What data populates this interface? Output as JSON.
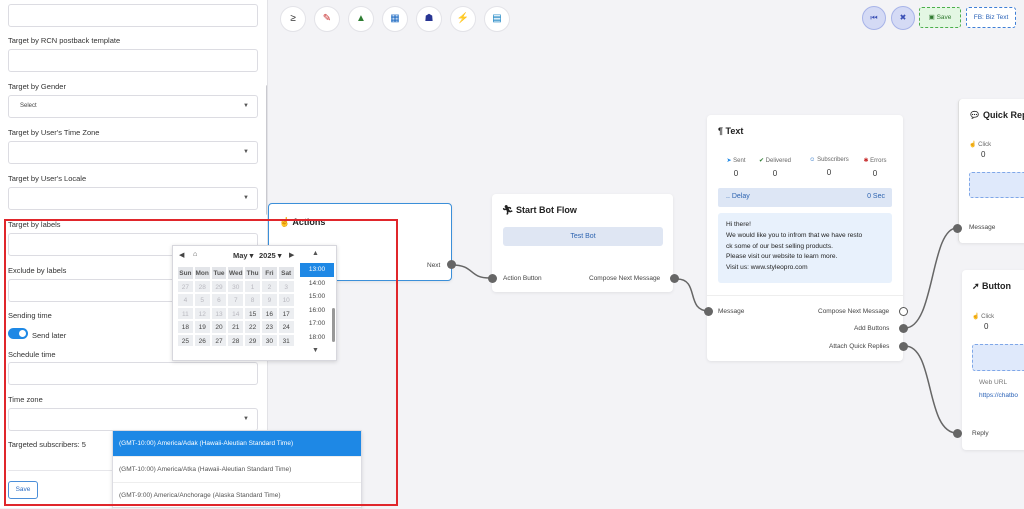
{
  "left_panel": {
    "fields": [
      {
        "label": "Target by RCN postback template"
      },
      {
        "label": "Target by Gender",
        "value": "Select"
      },
      {
        "label": "Target by User's Time Zone"
      },
      {
        "label": "Target by User's Locale"
      },
      {
        "label": "Target by labels"
      },
      {
        "label": "Exclude by labels"
      }
    ],
    "sending_time_label": "Sending time",
    "send_later_label": "Send later",
    "schedule_time_label": "Schedule time",
    "time_zone_label": "Time zone",
    "targeted_subscribers_label": "Targeted subscribers: 5",
    "save_label": "Save"
  },
  "datepicker": {
    "month": "May",
    "year": "2025",
    "weekdays": [
      "Sun",
      "Mon",
      "Tue",
      "Wed",
      "Thu",
      "Fri",
      "Sat"
    ],
    "weeks": [
      [
        "27",
        "28",
        "29",
        "30",
        "1",
        "2",
        "3"
      ],
      [
        "4",
        "5",
        "6",
        "7",
        "8",
        "9",
        "10"
      ],
      [
        "11",
        "12",
        "13",
        "14",
        "15",
        "16",
        "17"
      ],
      [
        "18",
        "19",
        "20",
        "21",
        "22",
        "23",
        "24"
      ],
      [
        "25",
        "26",
        "27",
        "28",
        "29",
        "30",
        "31"
      ]
    ],
    "times": [
      "13:00",
      "14:00",
      "15:00",
      "16:00",
      "17:00",
      "18:00"
    ],
    "selected_time": "13:00"
  },
  "timezone_options": [
    "(GMT-10:00) America/Adak (Hawaii-Aleutian Standard Time)",
    "(GMT-10:00) America/Atka (Hawaii-Aleutian Standard Time)",
    "(GMT-9:00) America/Anchorage (Alaska Standard Time)"
  ],
  "toolbar": {
    "save_label": "Save",
    "flow_name": "FB: Biz Text",
    "tool_icons": [
      "greater-equal-icon",
      "subscriber-icon",
      "chart-icon",
      "cards-icon",
      "robot-icon",
      "plug-icon",
      "file-icon"
    ]
  },
  "nodes": {
    "actions": {
      "title": "Actions",
      "port_next": "Next"
    },
    "start_bot_flow": {
      "title": "Start Bot Flow",
      "bot_name": "Test Bot",
      "port_in": "Action Button",
      "port_out": "Compose Next Message"
    },
    "text": {
      "title": "Text",
      "stats": [
        {
          "label": "Sent",
          "value": "0"
        },
        {
          "label": "Delivered",
          "value": "0"
        },
        {
          "label": "Subscribers",
          "value": "0"
        },
        {
          "label": "Errors",
          "value": "0"
        }
      ],
      "delay_label": ".. Delay",
      "delay_value": "0 Sec",
      "message_lines": [
        "Hi there!",
        "We would like you to infrom that we have resto",
        "ck some of our best selling products.",
        "Please visit our website to learn more.",
        "Visit us: www.styleopro.com"
      ],
      "port_in": "Message",
      "ports_out": [
        "Compose Next Message",
        "Add Buttons",
        "Attach Quick Replies"
      ]
    },
    "quick_reply": {
      "title": "Quick Rep",
      "click_label": "Click",
      "click_value": "0",
      "port_out": "Message"
    },
    "button": {
      "title": "Button",
      "click_label": "Click",
      "click_value": "0",
      "web_url_label": "Web URL",
      "web_url": "https://chatbo",
      "port_out": "Reply"
    }
  },
  "colors": {
    "accent": "#1e88e5",
    "highlight": "#e0262b",
    "save_green": "#e3f7e3"
  }
}
